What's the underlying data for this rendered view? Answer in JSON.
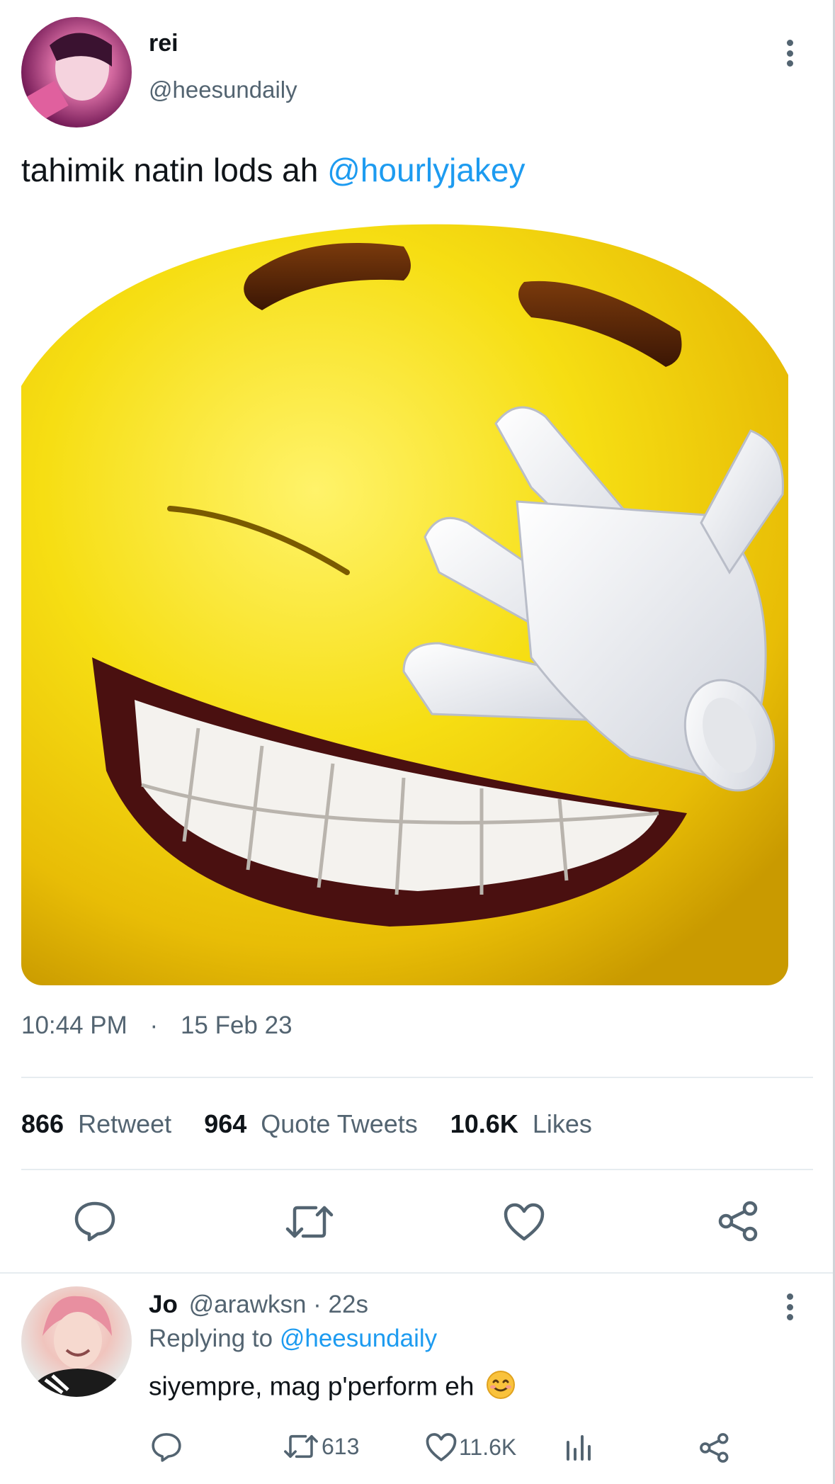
{
  "tweet": {
    "author": {
      "display_name": "rei",
      "handle": "@heesundaily"
    },
    "text_plain": "tahimik natin lods ah ",
    "text_mention": "@hourlyjakey",
    "time": "10:44 PM",
    "separator": "·",
    "date": "15 Feb 23",
    "stats": {
      "retweets_count": "866",
      "retweets_label": "Retweet",
      "quotes_count": "964",
      "quotes_label": "Quote Tweets",
      "likes_count": "10.6K",
      "likes_label": "Likes"
    }
  },
  "reply": {
    "author": {
      "display_name": "Jo",
      "handle_time": "@arawksn · 22s"
    },
    "replying_label": "Replying to ",
    "replying_handle": "@heesundaily",
    "text": "siyempre, mag p'perform eh",
    "emoji": "😊",
    "retweets": "613",
    "likes": "11.6K"
  },
  "colors": {
    "accent": "#1d9bf0",
    "muted": "#536471",
    "divider": "#e6ecf0"
  },
  "icons": [
    "more-icon",
    "reply-icon",
    "retweet-icon",
    "like-icon",
    "share-icon",
    "analytics-icon",
    "emoji-smile"
  ]
}
